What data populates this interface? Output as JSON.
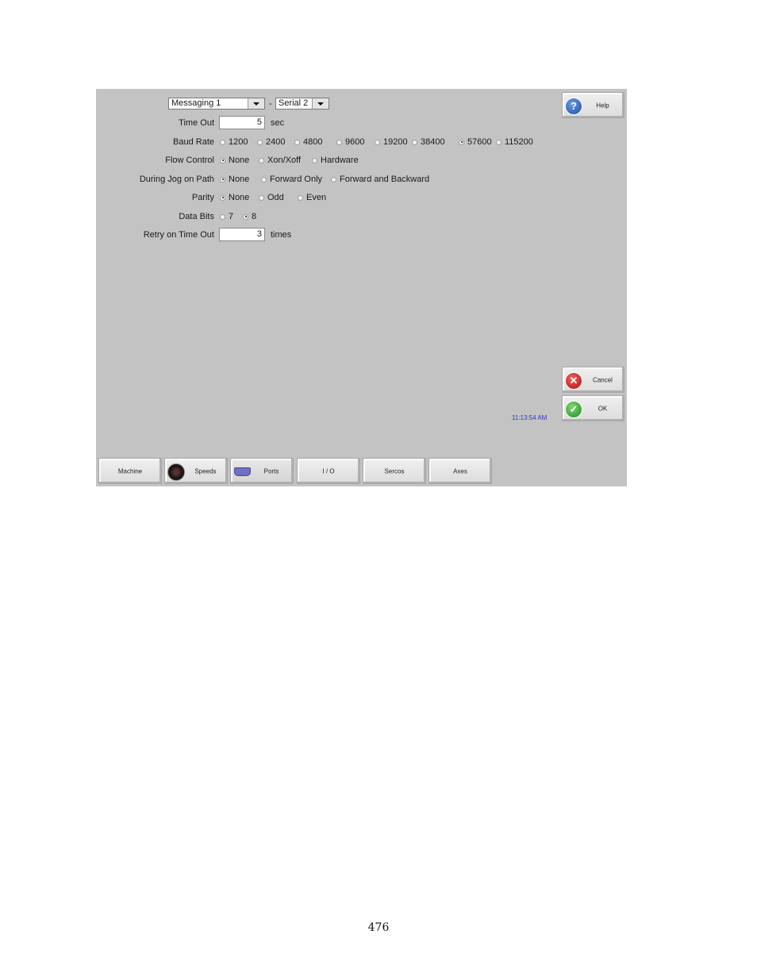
{
  "header": {
    "message_select": "Messaging 1",
    "separator": "-",
    "port_select": "Serial 2"
  },
  "form": {
    "timeout": {
      "label": "Time Out",
      "value": "5",
      "unit": "sec"
    },
    "baud_rate": {
      "label": "Baud Rate",
      "options": [
        "1200",
        "2400",
        "4800",
        "9600",
        "19200",
        "38400",
        "57600",
        "115200"
      ],
      "selected": "57600"
    },
    "flow_control": {
      "label": "Flow Control",
      "options": [
        "None",
        "Xon/Xoff",
        "Hardware"
      ],
      "selected": "None"
    },
    "jog_on_path": {
      "label": "During Jog on Path",
      "options": [
        "None",
        "Forward Only",
        "Forward and Backward"
      ],
      "selected": "None"
    },
    "parity": {
      "label": "Parity",
      "options": [
        "None",
        "Odd",
        "Even"
      ],
      "selected": "None"
    },
    "data_bits": {
      "label": "Data Bits",
      "options": [
        "7",
        "8"
      ],
      "selected": "8"
    },
    "retry": {
      "label": "Retry on Time Out",
      "value": "3",
      "unit": "times"
    }
  },
  "side_buttons": {
    "help": {
      "label": "Help",
      "icon": "question-icon",
      "color": "#2a5db0"
    },
    "cancel": {
      "label": "Cancel",
      "icon": "x-icon",
      "color": "#c8201e"
    },
    "ok": {
      "label": "OK",
      "icon": "check-icon",
      "color": "#2fa52f"
    }
  },
  "clock": "11:13:54 AM",
  "tabs": [
    {
      "label": "Machine"
    },
    {
      "label": "Speeds",
      "icon": "speedometer-icon"
    },
    {
      "label": "Ports",
      "icon": "serial-port-icon"
    },
    {
      "label": "I / O"
    },
    {
      "label": "Sercos"
    },
    {
      "label": "Axes"
    }
  ],
  "page_number": "476"
}
